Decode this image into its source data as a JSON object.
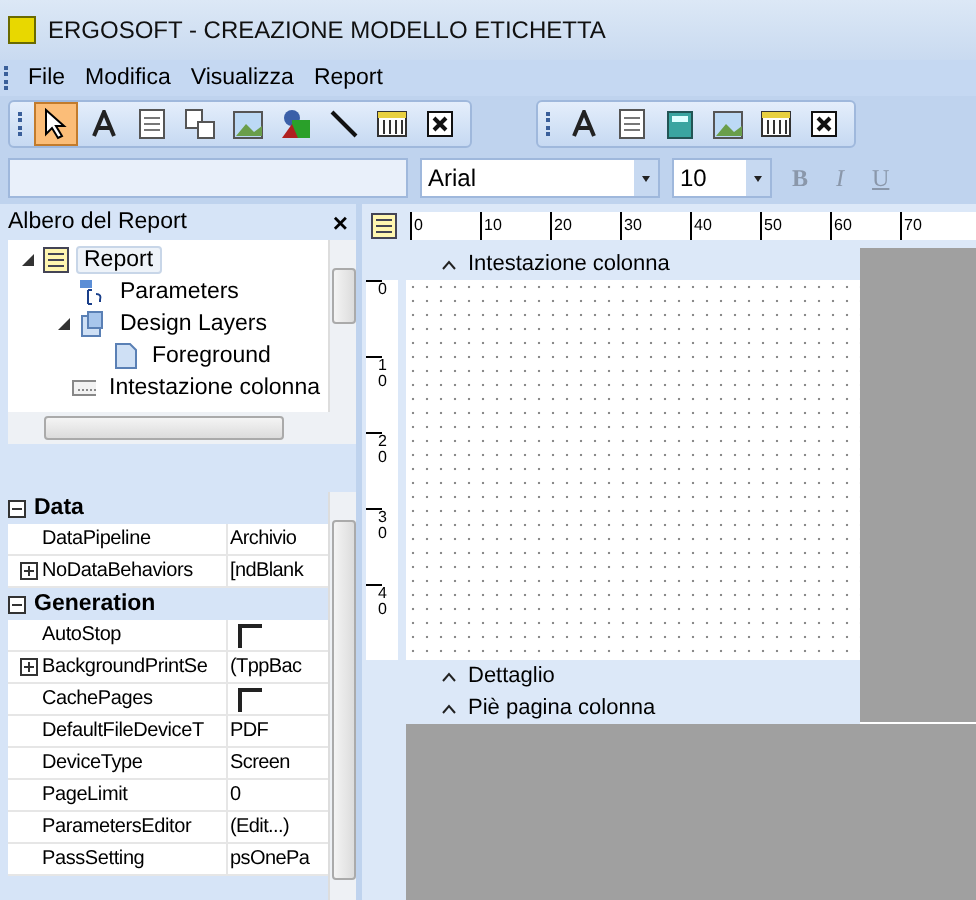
{
  "window": {
    "title": "ERGOSOFT - CREAZIONE MODELLO ETICHETTA"
  },
  "menu": [
    "File",
    "Modifica",
    "Visualizza",
    "Report"
  ],
  "toolbar": [
    {
      "kind": "pointer",
      "selected": true
    },
    {
      "kind": "text",
      "selected": false
    },
    {
      "kind": "memo",
      "selected": false
    },
    {
      "kind": "variable",
      "selected": false
    },
    {
      "kind": "image",
      "selected": false
    },
    {
      "kind": "shape",
      "selected": false
    },
    {
      "kind": "line",
      "selected": false
    },
    {
      "kind": "band",
      "selected": false
    },
    {
      "kind": "cancel",
      "selected": false
    }
  ],
  "data_toolbar": [
    {
      "kind": "text"
    },
    {
      "kind": "memo"
    },
    {
      "kind": "calc"
    },
    {
      "kind": "image"
    },
    {
      "kind": "band"
    },
    {
      "kind": "cancel"
    }
  ],
  "format_bar": {
    "font": "Arial",
    "size": "10",
    "buttons": [
      "B",
      "I",
      "U"
    ]
  },
  "tree_panel": {
    "title": "Albero del Report",
    "close": "×",
    "items": [
      {
        "label": "Report",
        "kind": "report",
        "selected": true,
        "expanded": true,
        "children": [
          {
            "label": "Parameters",
            "kind": "params",
            "selected": false
          },
          {
            "label": "Design Layers",
            "kind": "layers",
            "selected": false,
            "expanded": true,
            "children": [
              {
                "label": "Foreground",
                "kind": "page",
                "selected": false
              }
            ]
          },
          {
            "label": "Intestazione colonna",
            "kind": "band",
            "selected": false
          }
        ]
      }
    ]
  },
  "properties": [
    {
      "category": "Data",
      "expanded": true,
      "items": [
        {
          "name": "DataPipeline",
          "value": "Archivio",
          "kind": "text"
        },
        {
          "name": "NoDataBehaviors",
          "value": "[ndBlank",
          "kind": "expandable",
          "expanded": false
        }
      ]
    },
    {
      "category": "Generation",
      "expanded": true,
      "items": [
        {
          "name": "AutoStop",
          "kind": "checkbox",
          "checked": false
        },
        {
          "name": "BackgroundPrintSe",
          "value": "(TppBac",
          "kind": "expandable",
          "expanded": false
        },
        {
          "name": "CachePages",
          "kind": "checkbox",
          "checked": false
        },
        {
          "name": "DefaultFileDeviceT",
          "value": "PDF",
          "kind": "text"
        },
        {
          "name": "DeviceType",
          "value": "Screen",
          "kind": "text"
        },
        {
          "name": "PageLimit",
          "value": "0",
          "kind": "text"
        },
        {
          "name": "ParametersEditor",
          "value": "(Edit...)",
          "kind": "text"
        },
        {
          "name": "PassSetting",
          "value": "psOnePa",
          "kind": "text"
        }
      ]
    }
  ],
  "designer": {
    "h_ruler": [
      "0",
      "10",
      "20",
      "30",
      "40",
      "50",
      "60",
      "70"
    ],
    "v_ruler": [
      "0",
      "10",
      "20",
      "30",
      "40"
    ],
    "bands": [
      {
        "label": "Intestazione colonna",
        "kind": "header"
      },
      {
        "label": "Dettaglio",
        "kind": "detail"
      },
      {
        "label": "Piè pagina colonna",
        "kind": "footer"
      }
    ]
  }
}
